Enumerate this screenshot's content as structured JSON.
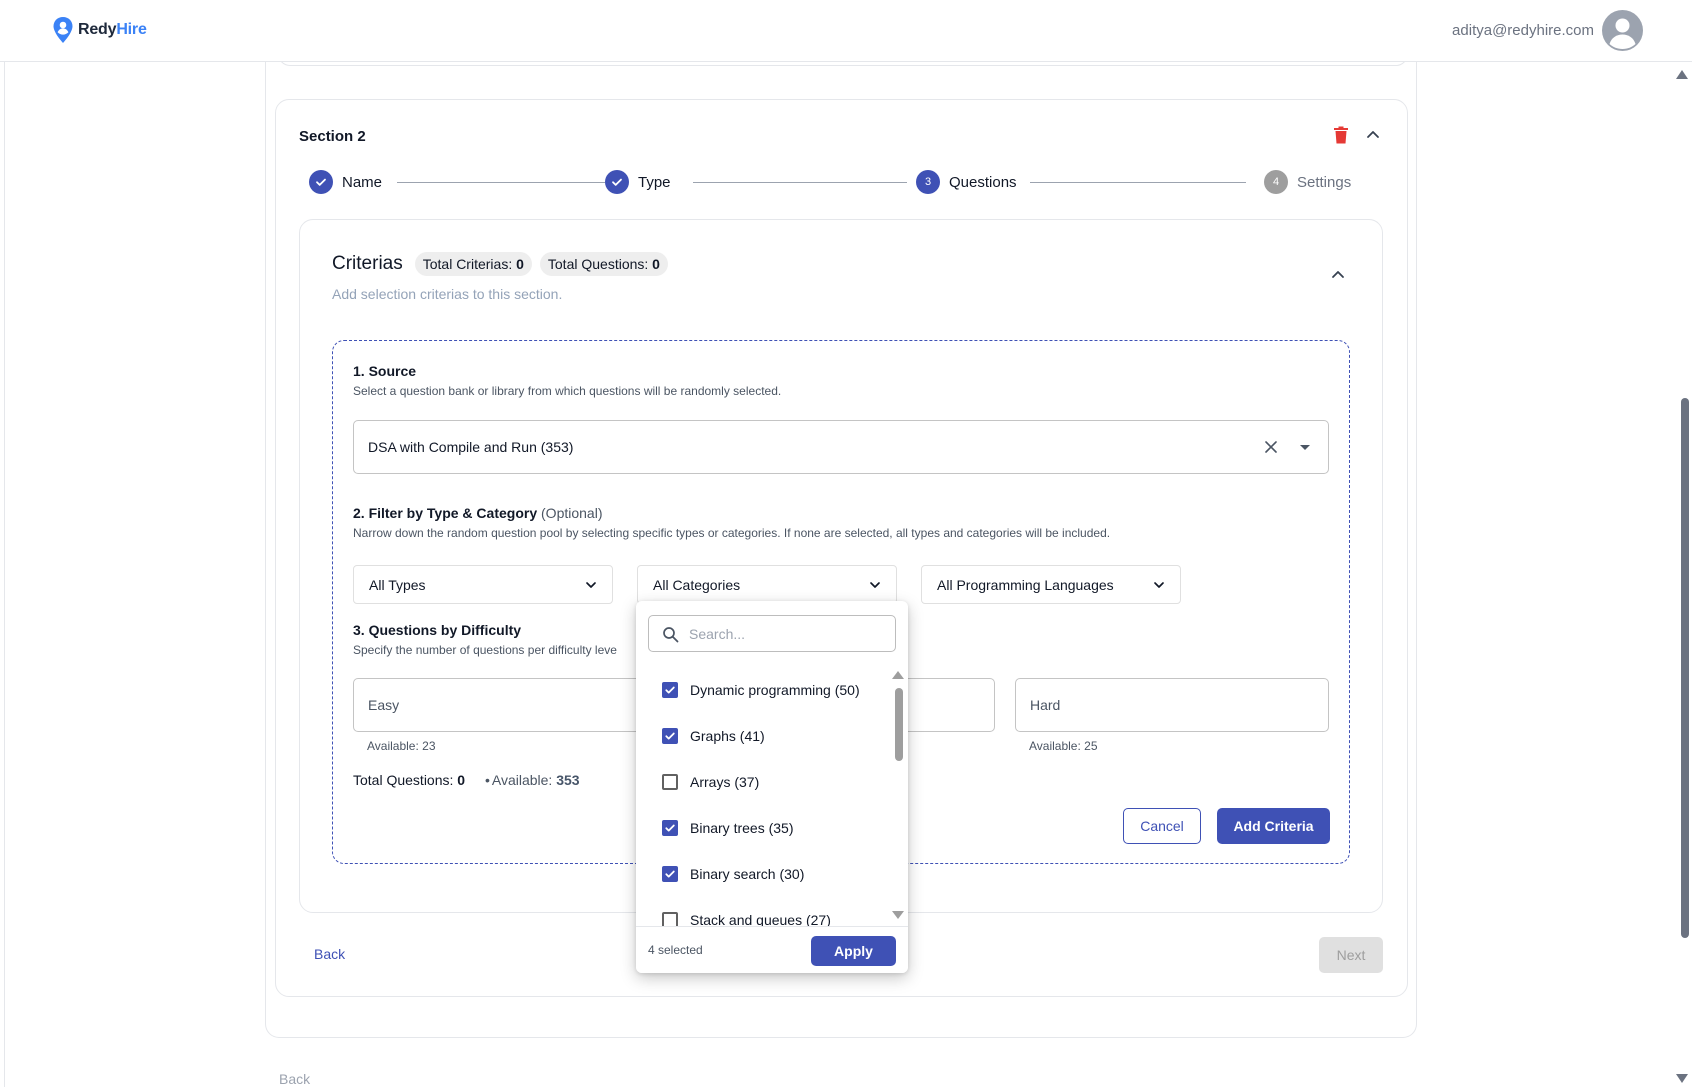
{
  "header": {
    "logo_text_a": "Redy",
    "logo_text_b": "Hire",
    "user_email": "aditya@redyhire.com"
  },
  "section": {
    "title": "Section 2",
    "steps": [
      {
        "number": "1",
        "label": "Name",
        "state": "done"
      },
      {
        "number": "2",
        "label": "Type",
        "state": "done"
      },
      {
        "number": "3",
        "label": "Questions",
        "state": "active"
      },
      {
        "number": "4",
        "label": "Settings",
        "state": "todo"
      }
    ]
  },
  "criterias": {
    "title": "Criterias",
    "total_criterias_label": "Total Criterias:",
    "total_criterias_value": "0",
    "total_questions_label": "Total Questions:",
    "total_questions_value": "0",
    "subtitle": "Add selection criterias to this section."
  },
  "form": {
    "source_heading": "1. Source",
    "source_desc": "Select a question bank or library from which questions will be randomly selected.",
    "source_value": "DSA with Compile and Run (353)",
    "filter_heading": "2. Filter by Type & Category",
    "filter_optional": "(Optional)",
    "filter_desc": "Narrow down the random question pool by selecting specific types or categories. If none are selected, all types and categories will be included.",
    "filter_types": "All Types",
    "filter_categories": "All Categories",
    "filter_languages": "All Programming Languages",
    "difficulty_heading": "3. Questions by Difficulty",
    "difficulty_desc": "Specify the number of questions per difficulty leve",
    "easy_label": "Easy",
    "hard_label": "Hard",
    "easy_available": "Available: 23",
    "hard_available": "Available: 25",
    "total_label": "Total Questions:",
    "total_value": "0",
    "available_label": "Available:",
    "available_value": "353",
    "cancel_label": "Cancel",
    "add_label": "Add Criteria"
  },
  "nav": {
    "back_label": "Back",
    "next_label": "Next",
    "page_back_label": "Back"
  },
  "dropdown": {
    "search_placeholder": "Search...",
    "items": [
      {
        "label": "Dynamic programming (50)",
        "checked": true
      },
      {
        "label": "Graphs (41)",
        "checked": true
      },
      {
        "label": "Arrays (37)",
        "checked": false
      },
      {
        "label": "Binary trees (35)",
        "checked": true
      },
      {
        "label": "Binary search (30)",
        "checked": true
      },
      {
        "label": "Stack and queues (27)",
        "checked": false
      }
    ],
    "selected_count": "4 selected",
    "apply_label": "Apply"
  },
  "colors": {
    "primary": "#3f51b5",
    "danger": "#e53935",
    "brand_blue": "#3b82f6"
  }
}
